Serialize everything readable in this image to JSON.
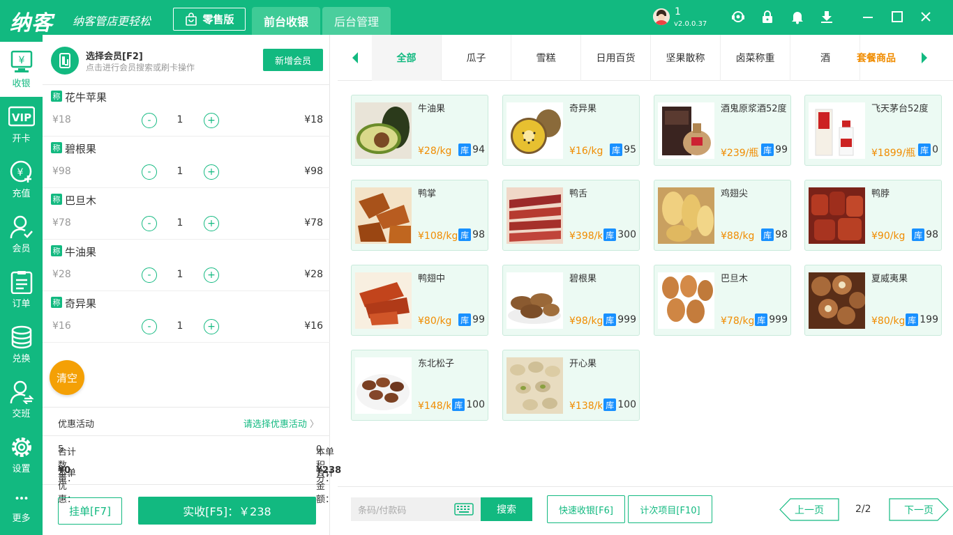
{
  "header": {
    "logo": "纳客",
    "slogan": "纳客管店更轻松",
    "edition": "零售版",
    "tabs": [
      "前台收银",
      "后台管理"
    ],
    "user": "1",
    "version": "v2.0.0.37"
  },
  "sidebar": {
    "items": [
      {
        "label": "收银",
        "icon": "cashier-icon"
      },
      {
        "label": "开卡",
        "icon": "vip-card-icon"
      },
      {
        "label": "充值",
        "icon": "recharge-icon"
      },
      {
        "label": "会员",
        "icon": "member-icon"
      },
      {
        "label": "订单",
        "icon": "order-icon"
      },
      {
        "label": "兑换",
        "icon": "exchange-icon"
      },
      {
        "label": "交班",
        "icon": "handover-icon"
      },
      {
        "label": "设置",
        "icon": "settings-icon"
      },
      {
        "label": "更多",
        "icon": "more-icon"
      }
    ]
  },
  "member": {
    "title": "选择会员[F2]",
    "subtitle": "点击进行会员搜索或刷卡操作",
    "add_button": "新增会员"
  },
  "cart": {
    "badge": "称",
    "items": [
      {
        "name": "花牛苹果",
        "unit_price": "¥18",
        "qty": "1",
        "total": "¥18"
      },
      {
        "name": "碧根果",
        "unit_price": "¥98",
        "qty": "1",
        "total": "¥98"
      },
      {
        "name": "巴旦木",
        "unit_price": "¥78",
        "qty": "1",
        "total": "¥78"
      },
      {
        "name": "牛油果",
        "unit_price": "¥28",
        "qty": "1",
        "total": "¥28"
      },
      {
        "name": "奇异果",
        "unit_price": "¥16",
        "qty": "1",
        "total": "¥16"
      }
    ],
    "minus": "-",
    "plus": "+",
    "clear_label": "清空",
    "promo_label": "优惠活动",
    "promo_select": "请选择优惠活动",
    "summary": {
      "qty_label": "合计数量：",
      "qty_value": "5",
      "points_label": "本单积分：",
      "points_value": "0",
      "discount_label": "本单优惠：",
      "discount_value": "¥0",
      "total_label": "合计金额：",
      "total_value": "¥238"
    },
    "hold_button": "挂单[F7]",
    "pay_button": "实收[F5]：￥238"
  },
  "categories": {
    "items": [
      "全部",
      "瓜子",
      "雪糕",
      "日用百货",
      "坚果散称",
      "卤菜称重",
      "酒",
      "套餐商品"
    ]
  },
  "products": {
    "stock_badge": "库",
    "items": [
      {
        "name": "牛油果",
        "price": "¥28/kg",
        "stock": "94"
      },
      {
        "name": "奇异果",
        "price": "¥16/kg",
        "stock": "95"
      },
      {
        "name": "酒鬼原浆酒52度",
        "price": "¥239/瓶",
        "stock": "99"
      },
      {
        "name": "飞天茅台52度",
        "price": "¥1899/瓶",
        "stock": "0"
      },
      {
        "name": "鸭掌",
        "price": "¥108/kg",
        "stock": "98"
      },
      {
        "name": "鸭舌",
        "price": "¥398/kg",
        "stock": "300"
      },
      {
        "name": "鸡翅尖",
        "price": "¥88/kg",
        "stock": "98"
      },
      {
        "name": "鸭脖",
        "price": "¥90/kg",
        "stock": "98"
      },
      {
        "name": "鸭翅中",
        "price": "¥80/kg",
        "stock": "99"
      },
      {
        "name": "碧根果",
        "price": "¥98/kg",
        "stock": "999"
      },
      {
        "name": "巴旦木",
        "price": "¥78/kg",
        "stock": "999"
      },
      {
        "name": "夏威夷果",
        "price": "¥80/kg",
        "stock": "199"
      },
      {
        "name": "东北松子",
        "price": "¥148/kg",
        "stock": "100"
      },
      {
        "name": "开心果",
        "price": "¥138/kg",
        "stock": "100"
      }
    ]
  },
  "bottom": {
    "search_placeholder": "条码/付款码",
    "search_button": "搜索",
    "quick_cashier": "快速收银[F6]",
    "count_items": "计次项目[F10]",
    "prev_page": "上一页",
    "page": "2/2",
    "next_page": "下一页"
  },
  "colors": {
    "accent": "#12b980",
    "price": "#f08c00",
    "stock_badge": "#1890ff",
    "clear_button": "#f4a005",
    "discount": "#ee3333"
  }
}
